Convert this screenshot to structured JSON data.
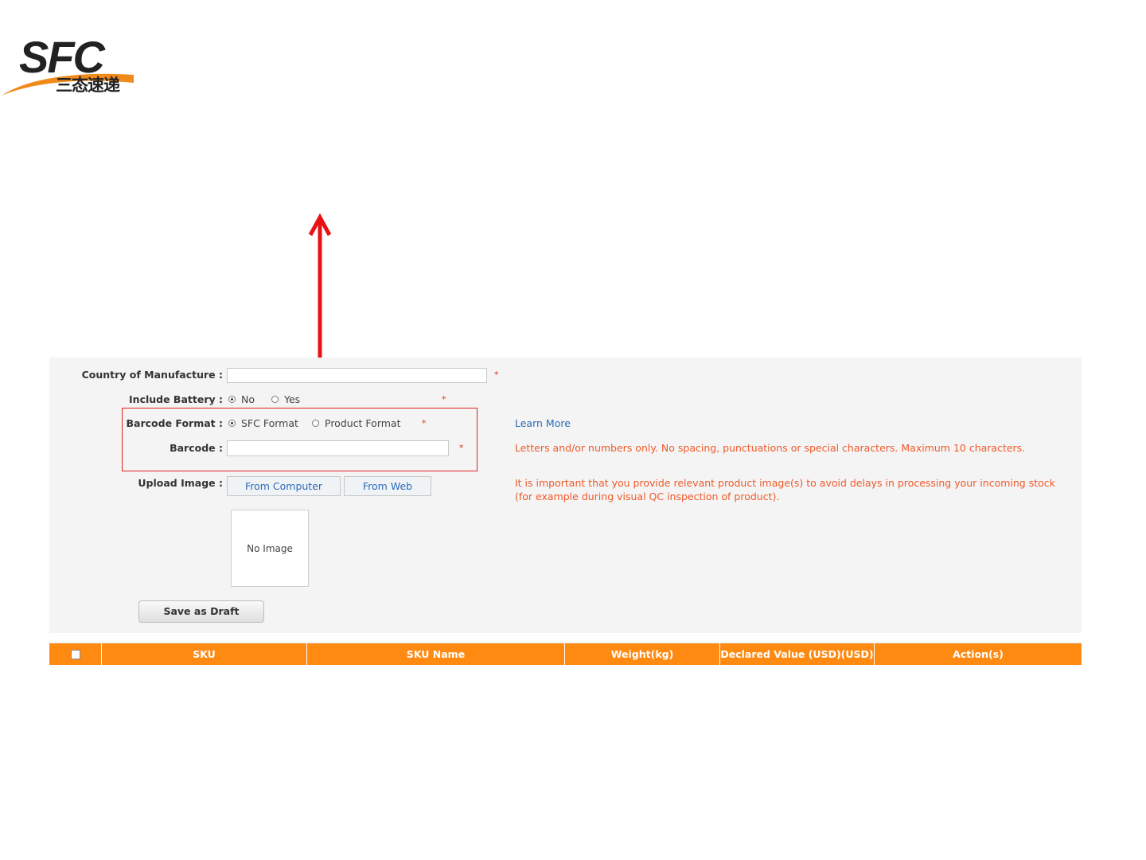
{
  "brand": {
    "logo_text": "SFC",
    "logo_subtitle": "三态速递",
    "colors": {
      "accent": "#ff8a12",
      "brand_orange": "#f08a1a",
      "annotation_red": "#e02020",
      "hint_text": "#ef5a2a",
      "link": "#2a6bb8"
    }
  },
  "form": {
    "country_label": "Country of Manufacture :",
    "country_value": "",
    "required_mark": "*",
    "battery": {
      "label": "Include Battery :",
      "options": [
        "No",
        "Yes"
      ],
      "selected": "No"
    },
    "barcode_format": {
      "label": "Barcode Format :",
      "options": [
        "SFC Format",
        "Product Format"
      ],
      "selected": "SFC Format"
    },
    "barcode": {
      "label": "Barcode :",
      "value": ""
    },
    "upload": {
      "label": "Upload Image :",
      "from_computer": "From Computer",
      "from_web": "From Web",
      "placeholder": "No Image"
    },
    "learn_more": "Learn More",
    "barcode_hint": "Letters and/or numbers only. No spacing, punctuations or special characters. Maximum 10 characters.",
    "image_hint_1": "It is important that you provide relevant product image(s) to avoid delays in processing your incoming stock",
    "image_hint_2": "(for example during visual QC inspection of product).",
    "save_draft": "Save as Draft"
  },
  "table": {
    "columns": [
      "SKU",
      "SKU Name",
      "Weight(kg)",
      "Declared Value (USD)(USD)",
      "Action(s)"
    ]
  }
}
